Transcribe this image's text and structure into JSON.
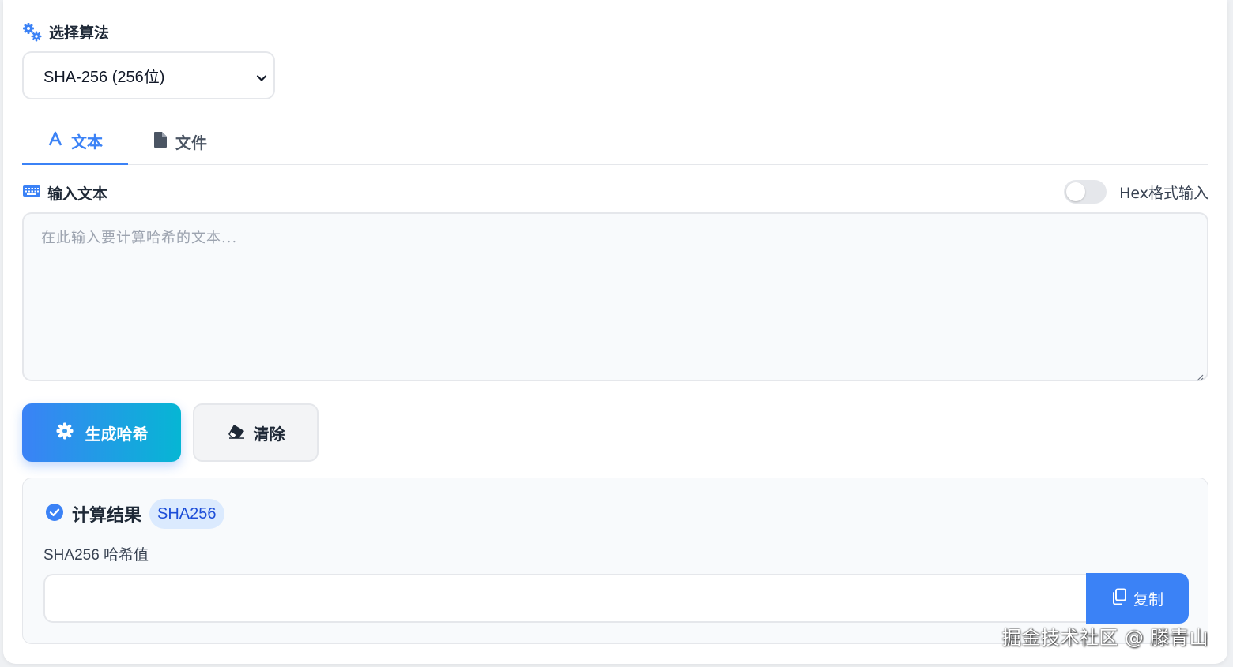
{
  "algorithm": {
    "label": "选择算法",
    "selected": "SHA-256 (256位)"
  },
  "tabs": [
    {
      "label": "文本",
      "icon": "font-icon",
      "active": true
    },
    {
      "label": "文件",
      "icon": "file-icon",
      "active": false
    }
  ],
  "input": {
    "label": "输入文本",
    "placeholder": "在此输入要计算哈希的文本...",
    "value": ""
  },
  "hex_toggle": {
    "label": "Hex格式输入",
    "on": false
  },
  "buttons": {
    "generate": "生成哈希",
    "clear": "清除"
  },
  "result": {
    "title": "计算结果",
    "badge": "SHA256",
    "hash_label": "SHA256 哈希值",
    "hash_value": "",
    "copy_label": "复制"
  },
  "watermark": "掘金技术社区 @ 滕青山",
  "colors": {
    "accent": "#3b82f6",
    "gradient_end": "#06b6d4",
    "badge_bg": "#dbeafe"
  }
}
